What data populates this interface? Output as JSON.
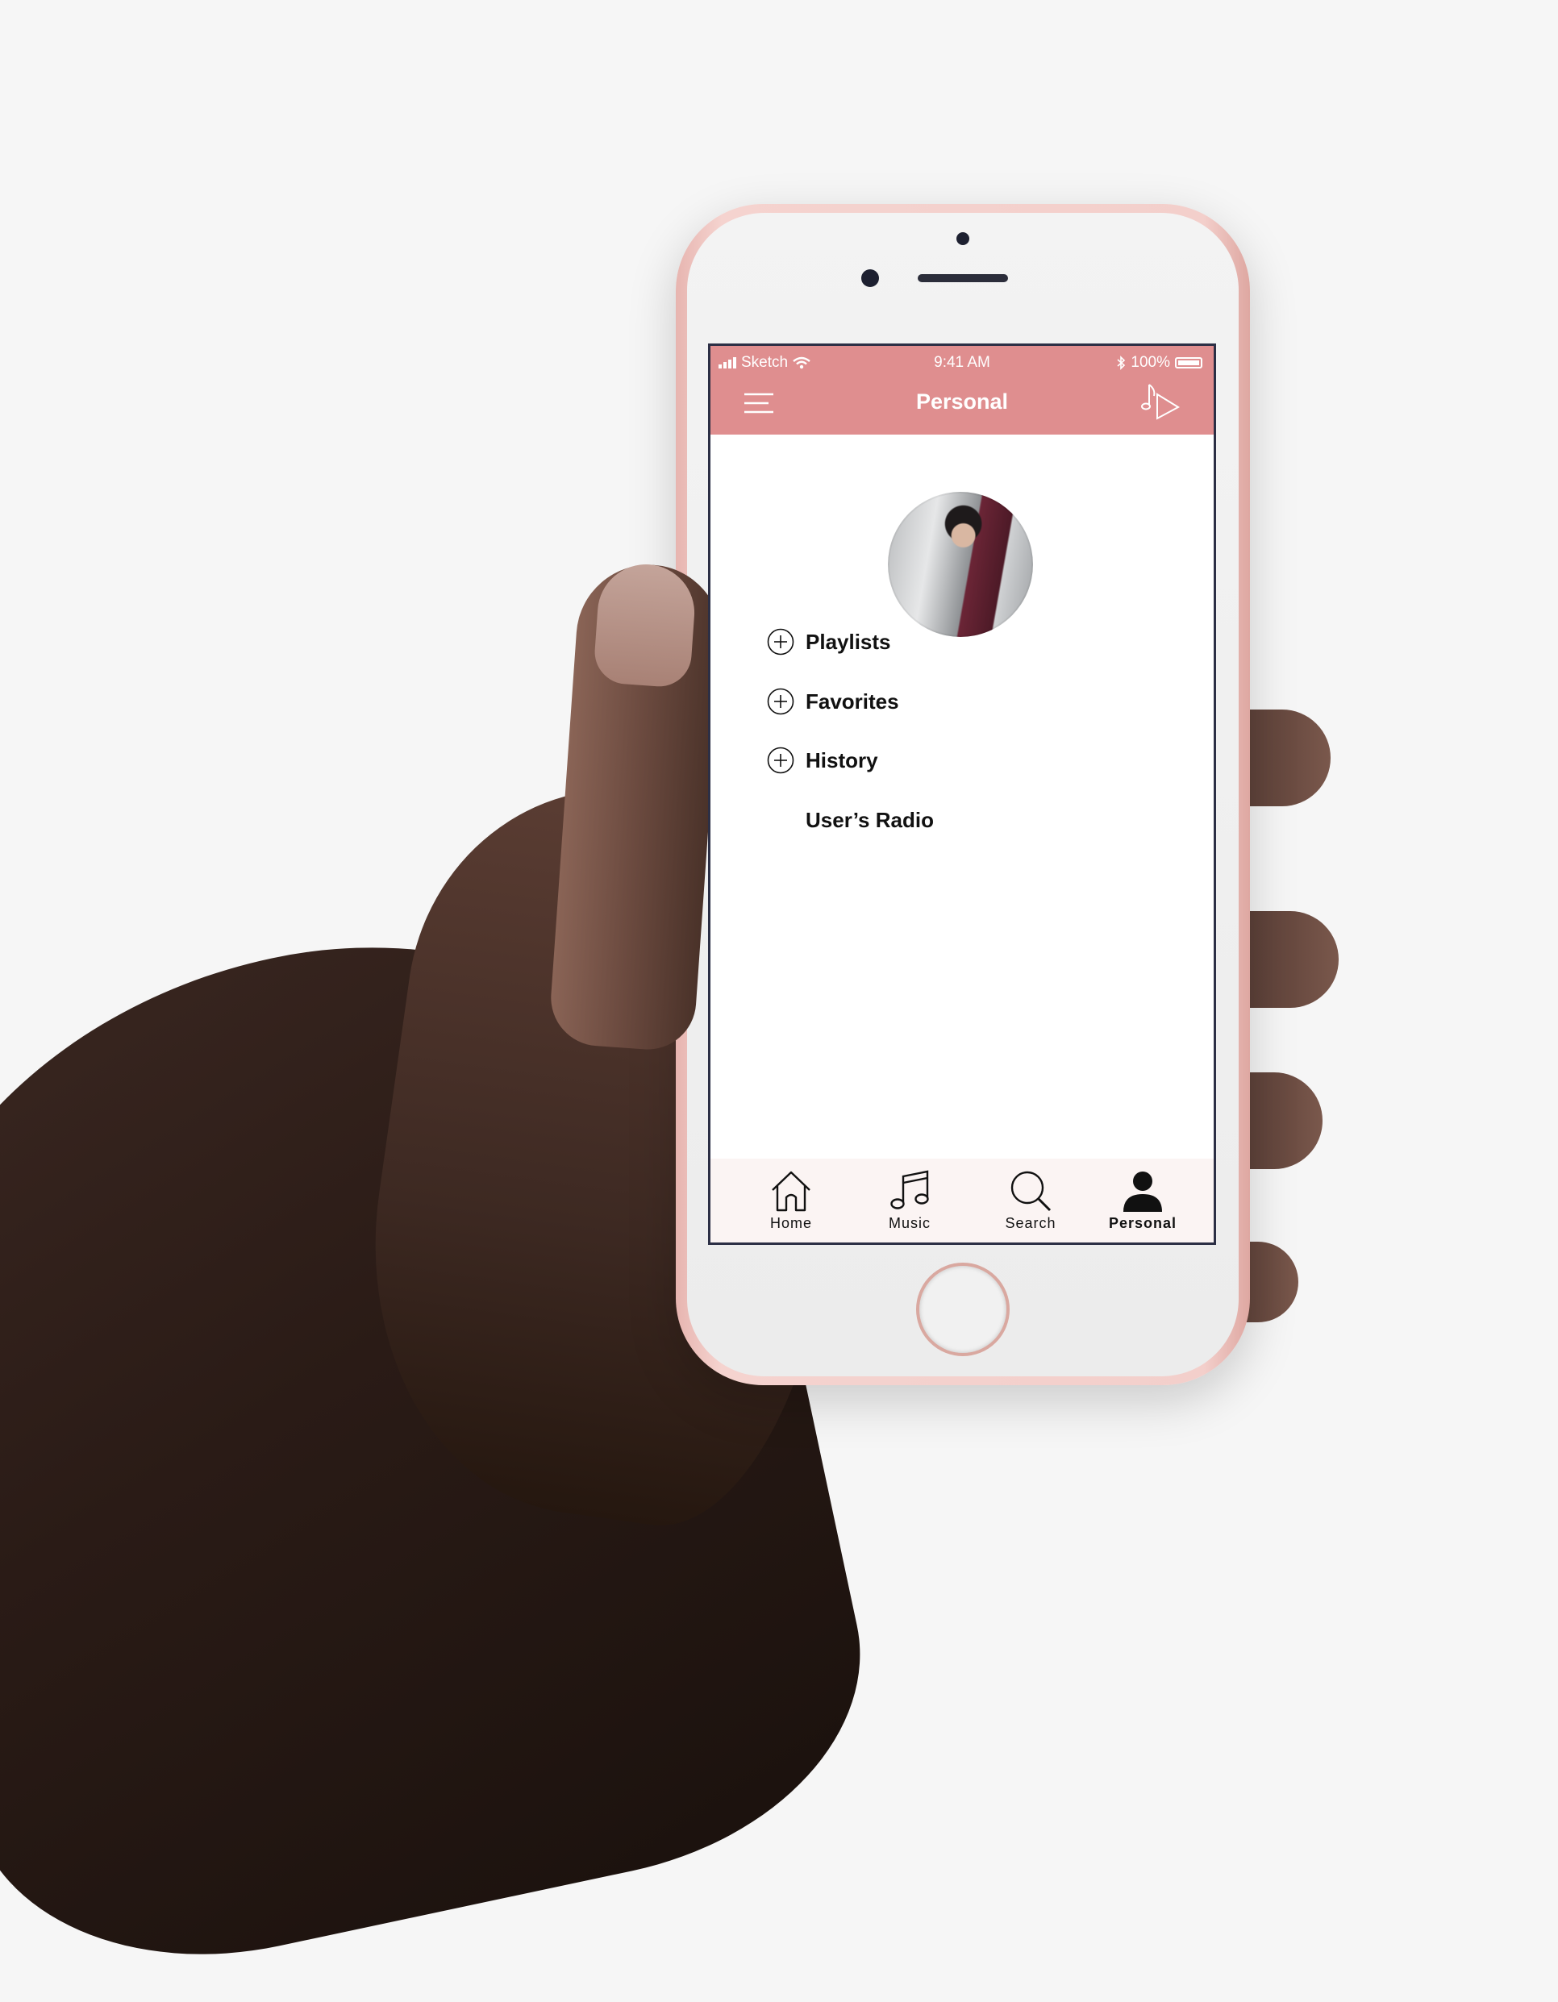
{
  "status_bar": {
    "carrier": "Sketch",
    "time": "9:41 AM",
    "battery": "100%"
  },
  "header": {
    "title": "Personal"
  },
  "profile": {
    "avatar_alt": "Profile photo"
  },
  "menu": {
    "items": [
      {
        "label": "Playlists",
        "icon": "plus-circle-icon"
      },
      {
        "label": "Favorites",
        "icon": "plus-circle-icon"
      },
      {
        "label": "History",
        "icon": "plus-circle-icon"
      },
      {
        "label": "User’s Radio",
        "icon": ""
      }
    ]
  },
  "tabbar": {
    "tabs": [
      {
        "label": "Home",
        "icon": "home-icon",
        "active": false
      },
      {
        "label": "Music",
        "icon": "music-note-icon",
        "active": false
      },
      {
        "label": "Search",
        "icon": "search-icon",
        "active": false
      },
      {
        "label": "Personal",
        "icon": "person-icon",
        "active": true
      }
    ]
  },
  "colors": {
    "accent": "#df8e8f",
    "tabbar_bg": "#fbf4f3",
    "text": "#111111"
  }
}
